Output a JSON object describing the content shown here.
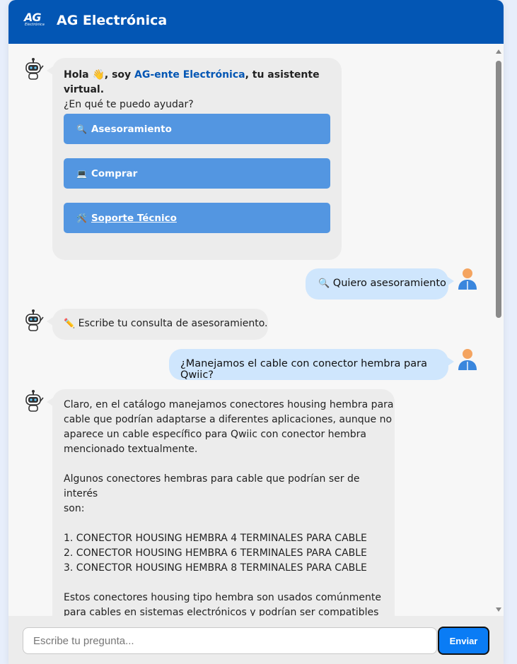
{
  "header": {
    "logo_text": "AG",
    "logo_sub": "Electrónica",
    "title": "AG Electrónica"
  },
  "messages": {
    "greeting": {
      "hola": "Hola 👋, soy ",
      "assistant_name": "AG-ente Electrónica",
      "rest": ", tu asistente virtual.",
      "question": "¿En qué te puedo ayudar?"
    },
    "options": [
      {
        "icon": "🔍",
        "label": "Asesoramiento"
      },
      {
        "icon": "💻",
        "label": "Comprar"
      },
      {
        "icon": "🛠️",
        "label": "Soporte Técnico"
      }
    ],
    "user_1": {
      "icon": "🔍",
      "text": "Quiero asesoramiento"
    },
    "bot_2": {
      "icon": "✏️",
      "text": "Escribe tu consulta de asesoramiento."
    },
    "user_2": {
      "text": "¿Manejamos el cable con conector hembra para Qwiic?"
    },
    "bot_3": {
      "text": "Claro, en el catálogo manejamos conectores housing hembra para\ncable que podrían adaptarse a diferentes aplicaciones, aunque no\naparece un cable específico para Qwiic con conector hembra\nmencionado textualmente.\n\nAlgunos conectores hembras para cable que podrían ser de interés\nson:\n\n1. CONECTOR HOUSING HEMBRA 4 TERMINALES PARA CABLE\n2. CONECTOR HOUSING HEMBRA 6 TERMINALES PARA CABLE\n3. CONECTOR HOUSING HEMBRA 8 TERMINALES PARA CABLE\n\nEstos conectores housing tipo hembra son usados comúnmente\npara cables en sistemas electrónicos y podrían ser compatibles\ndependiendo del pinout y tamaño del conector Qwiic que requieras."
    }
  },
  "footer": {
    "placeholder": "Escribe tu pregunta...",
    "send_label": "Enviar"
  },
  "colors": {
    "header": "#0356b4",
    "option_button": "#5396e1",
    "user_bubble": "#cfe6fd",
    "bot_bubble": "#ececec",
    "send_button": "#0a7cf5"
  }
}
